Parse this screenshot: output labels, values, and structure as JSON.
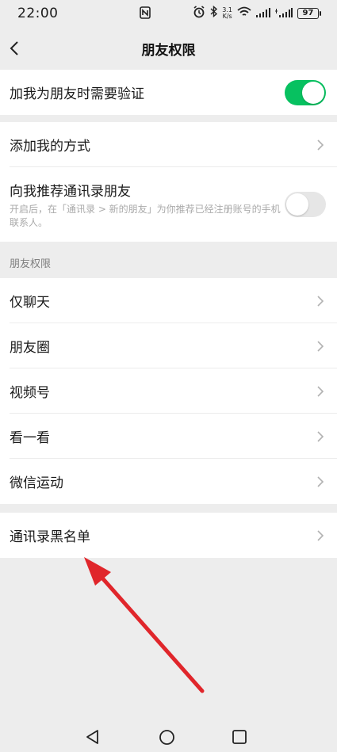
{
  "status_bar": {
    "time": "22:00",
    "speed_value": "3.1",
    "speed_unit": "K/s",
    "battery": "97",
    "icons": [
      "nfc-icon",
      "alarm-icon",
      "bluetooth-icon",
      "wifi-icon",
      "signal-icon",
      "signal-icon",
      "battery-icon"
    ]
  },
  "nav": {
    "title": "朋友权限",
    "back_icon": "chevron-left-icon"
  },
  "verify": {
    "label": "加我为朋友时需要验证",
    "enabled": true
  },
  "add_methods": {
    "label": "添加我的方式"
  },
  "recommend": {
    "title": "向我推荐通讯录朋友",
    "description": "开启后，在「通讯录 > 新的朋友」为你推荐已经注册账号的手机联系人。",
    "enabled": false
  },
  "permissions_section": {
    "header": "朋友权限",
    "items": [
      {
        "label": "仅聊天"
      },
      {
        "label": "朋友圈"
      },
      {
        "label": "视频号"
      },
      {
        "label": "看一看"
      },
      {
        "label": "微信运动"
      }
    ]
  },
  "blacklist": {
    "label": "通讯录黑名单"
  },
  "colors": {
    "toggle_on": "#07c160",
    "annotation_arrow": "#e0262b",
    "background": "#ededed"
  },
  "system_nav": [
    "back-triangle-icon",
    "home-circle-icon",
    "recents-square-icon"
  ]
}
